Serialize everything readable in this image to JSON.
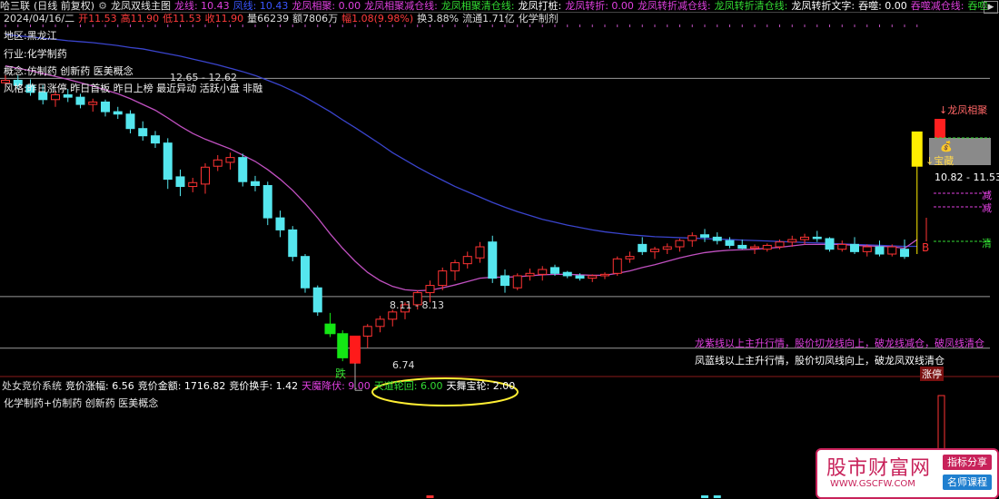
{
  "topbar": {
    "stock": "哈三联",
    "period": "(日线 前复权)",
    "indicator": "龙凤双线主图",
    "items": [
      {
        "text": "龙线: 10.43",
        "color": "#e040e0"
      },
      {
        "text": "凤线: 10.43",
        "color": "#3a55ff"
      },
      {
        "text": "龙凤相聚: 0.00",
        "color": "#e040e0"
      },
      {
        "text": "龙凤相聚减仓线:",
        "color": "#e040e0"
      },
      {
        "text": "龙凤相聚清仓线:",
        "color": "#33dd33"
      },
      {
        "text": "龙凤打桩:",
        "color": "#ffffff"
      },
      {
        "text": "龙凤转折: 0.00",
        "color": "#e040e0"
      },
      {
        "text": "龙凤转折减仓线:",
        "color": "#e040e0"
      },
      {
        "text": "龙凤转折清仓线:",
        "color": "#33dd33"
      },
      {
        "text": "龙凤转折文字:",
        "color": "#ffffff"
      },
      {
        "text": "吞噬: 0.00",
        "color": "#ffffff"
      },
      {
        "text": "吞噬减仓线:",
        "color": "#e040e0"
      },
      {
        "text": "吞噬:",
        "color": "#33dd33"
      }
    ]
  },
  "statline": [
    {
      "text": "2024/04/16/二",
      "color": "#dddddd"
    },
    {
      "text": "开11.53",
      "color": "#ff3b3b"
    },
    {
      "text": "高11.90",
      "color": "#ff3b3b"
    },
    {
      "text": "低11.53",
      "color": "#ff3b3b"
    },
    {
      "text": "收11.90",
      "color": "#ff3b3b"
    },
    {
      "text": "量66239",
      "color": "#dddddd"
    },
    {
      "text": "额7806万",
      "color": "#dddddd"
    },
    {
      "text": "幅1.08(9.98%)",
      "color": "#ff3b3b"
    },
    {
      "text": "换3.88%",
      "color": "#dddddd"
    },
    {
      "text": "流通1.71亿",
      "color": "#dddddd"
    },
    {
      "text": "化学制剂",
      "color": "#dddddd"
    }
  ],
  "labels": {
    "l1": "地区:黑龙江",
    "l2": "行业:化学制药",
    "l3": "概念:仿制药 创新药 医美概念",
    "l4": "风格:昨日涨停 昨日首板 昨日上榜 最近异动 活跃小盘 非融",
    "range1": "12.65 - 12.62",
    "range2": "8.11 - 8.13",
    "low": "6.74",
    "range3": "10.82 - 11.53",
    "die": "跌",
    "B": "B",
    "longxiang": "↓龙凤相聚",
    "baowuz": "↓宝藏",
    "jian1": "减",
    "jian2": "减",
    "qing": "清",
    "note1": "龙紫线以上主升行情，股价切龙线向上，破龙线减仓，破凤线清仓",
    "note2": "凤蓝线以上主升行情，股价切凤线向上，破龙凤双线清仓",
    "zhangting": "涨停"
  },
  "subbar": [
    {
      "text": "处女竞价系统",
      "color": "#dddddd"
    },
    {
      "text": "竞价涨幅: 6.56",
      "color": "#ffffff"
    },
    {
      "text": "竞价金额: 1716.82",
      "color": "#ffffff"
    },
    {
      "text": "竞价换手: 1.42",
      "color": "#ffffff"
    },
    {
      "text": "天魔降伏: 9.00",
      "color": "#e040e0"
    },
    {
      "text": "天道轮回: 6.00",
      "color": "#33dd33"
    },
    {
      "text": "天舞宝轮: 2.00",
      "color": "#ffffff"
    }
  ],
  "subconcept": "化学制药+仿制药 创新药 医美概念",
  "watermark": {
    "big": "股市财富网",
    "site": "WWW.GSCFW.COM",
    "b1": "指标分享",
    "b2": "名师课程"
  },
  "colors": {
    "up": "#ff3333",
    "down": "#55e6ee",
    "limitup": "#ff1a1a",
    "limitdown": "#14e614",
    "long": "#c050c0",
    "feng": "#3a44cc"
  },
  "chart_data": {
    "type": "candlestick",
    "title": "龙凤双线主图",
    "candles": [
      {
        "o": 12.55,
        "h": 12.72,
        "l": 12.45,
        "c": 12.6
      },
      {
        "o": 12.6,
        "h": 12.7,
        "l": 12.42,
        "c": 12.5
      },
      {
        "o": 12.5,
        "h": 12.62,
        "l": 12.28,
        "c": 12.35
      },
      {
        "o": 12.35,
        "h": 12.5,
        "l": 12.1,
        "c": 12.2
      },
      {
        "o": 12.2,
        "h": 12.38,
        "l": 12.05,
        "c": 12.3
      },
      {
        "o": 12.3,
        "h": 12.42,
        "l": 12.15,
        "c": 12.25
      },
      {
        "o": 12.25,
        "h": 12.32,
        "l": 12.02,
        "c": 12.1
      },
      {
        "o": 12.1,
        "h": 12.22,
        "l": 11.95,
        "c": 12.15
      },
      {
        "o": 12.15,
        "h": 12.2,
        "l": 11.85,
        "c": 11.95
      },
      {
        "o": 11.95,
        "h": 12.05,
        "l": 11.8,
        "c": 11.9
      },
      {
        "o": 11.9,
        "h": 11.98,
        "l": 11.5,
        "c": 11.6
      },
      {
        "o": 11.6,
        "h": 11.75,
        "l": 11.35,
        "c": 11.45
      },
      {
        "o": 11.45,
        "h": 11.55,
        "l": 11.2,
        "c": 11.3
      },
      {
        "o": 11.3,
        "h": 11.4,
        "l": 10.35,
        "c": 10.55
      },
      {
        "o": 10.6,
        "h": 10.75,
        "l": 10.2,
        "c": 10.4
      },
      {
        "o": 10.4,
        "h": 10.58,
        "l": 10.28,
        "c": 10.48
      },
      {
        "o": 10.45,
        "h": 10.88,
        "l": 10.25,
        "c": 10.8
      },
      {
        "o": 10.82,
        "h": 11.05,
        "l": 10.72,
        "c": 10.95
      },
      {
        "o": 10.9,
        "h": 11.1,
        "l": 10.75,
        "c": 11.0
      },
      {
        "o": 11.0,
        "h": 11.08,
        "l": 10.4,
        "c": 10.5
      },
      {
        "o": 10.5,
        "h": 10.62,
        "l": 10.3,
        "c": 10.42
      },
      {
        "o": 10.42,
        "h": 10.5,
        "l": 9.6,
        "c": 9.75
      },
      {
        "o": 9.75,
        "h": 9.9,
        "l": 9.35,
        "c": 9.5
      },
      {
        "o": 9.5,
        "h": 9.58,
        "l": 8.85,
        "c": 8.95
      },
      {
        "o": 8.95,
        "h": 9.0,
        "l": 8.2,
        "c": 8.3
      },
      {
        "o": 8.3,
        "h": 8.35,
        "l": 7.72,
        "c": 7.8
      },
      {
        "o": 7.55,
        "h": 7.78,
        "l": 7.28,
        "c": 7.35
      },
      {
        "o": 7.35,
        "h": 7.42,
        "l": 6.78,
        "c": 6.85
      },
      {
        "o": 6.74,
        "h": 7.3,
        "l": 6.74,
        "c": 7.3
      },
      {
        "o": 7.3,
        "h": 7.55,
        "l": 7.05,
        "c": 7.5
      },
      {
        "o": 7.5,
        "h": 7.72,
        "l": 7.38,
        "c": 7.65
      },
      {
        "o": 7.65,
        "h": 7.85,
        "l": 7.5,
        "c": 7.8
      },
      {
        "o": 7.8,
        "h": 8.0,
        "l": 7.65,
        "c": 7.95
      },
      {
        "o": 7.95,
        "h": 8.25,
        "l": 7.85,
        "c": 8.2
      },
      {
        "o": 8.2,
        "h": 8.45,
        "l": 8.0,
        "c": 8.35
      },
      {
        "o": 8.35,
        "h": 8.72,
        "l": 8.25,
        "c": 8.65
      },
      {
        "o": 8.65,
        "h": 8.88,
        "l": 8.45,
        "c": 8.82
      },
      {
        "o": 8.8,
        "h": 9.05,
        "l": 8.7,
        "c": 8.95
      },
      {
        "o": 8.92,
        "h": 9.25,
        "l": 8.82,
        "c": 9.15
      },
      {
        "o": 9.25,
        "h": 9.38,
        "l": 8.4,
        "c": 8.5
      },
      {
        "o": 8.55,
        "h": 8.68,
        "l": 8.2,
        "c": 8.35
      },
      {
        "o": 8.3,
        "h": 8.6,
        "l": 8.25,
        "c": 8.55
      },
      {
        "o": 8.55,
        "h": 8.7,
        "l": 8.45,
        "c": 8.6
      },
      {
        "o": 8.58,
        "h": 8.75,
        "l": 8.45,
        "c": 8.68
      },
      {
        "o": 8.72,
        "h": 8.78,
        "l": 8.55,
        "c": 8.6
      },
      {
        "o": 8.62,
        "h": 8.65,
        "l": 8.5,
        "c": 8.55
      },
      {
        "o": 8.55,
        "h": 8.6,
        "l": 8.45,
        "c": 8.5
      },
      {
        "o": 8.5,
        "h": 8.58,
        "l": 8.42,
        "c": 8.55
      },
      {
        "o": 8.55,
        "h": 8.62,
        "l": 8.48,
        "c": 8.58
      },
      {
        "o": 8.6,
        "h": 8.95,
        "l": 8.55,
        "c": 8.9
      },
      {
        "o": 8.9,
        "h": 9.05,
        "l": 8.82,
        "c": 8.95
      },
      {
        "o": 9.2,
        "h": 9.35,
        "l": 8.98,
        "c": 9.05
      },
      {
        "o": 9.05,
        "h": 9.15,
        "l": 8.9,
        "c": 9.1
      },
      {
        "o": 9.1,
        "h": 9.22,
        "l": 9.0,
        "c": 9.15
      },
      {
        "o": 9.15,
        "h": 9.32,
        "l": 9.05,
        "c": 9.28
      },
      {
        "o": 9.28,
        "h": 9.45,
        "l": 9.15,
        "c": 9.38
      },
      {
        "o": 9.4,
        "h": 9.52,
        "l": 9.25,
        "c": 9.35
      },
      {
        "o": 9.35,
        "h": 9.45,
        "l": 9.2,
        "c": 9.28
      },
      {
        "o": 9.28,
        "h": 9.35,
        "l": 9.12,
        "c": 9.18
      },
      {
        "o": 9.18,
        "h": 9.3,
        "l": 9.1,
        "c": 9.12
      },
      {
        "o": 9.12,
        "h": 9.2,
        "l": 9.0,
        "c": 9.15
      },
      {
        "o": 9.1,
        "h": 9.22,
        "l": 9.05,
        "c": 9.18
      },
      {
        "o": 9.15,
        "h": 9.3,
        "l": 9.1,
        "c": 9.25
      },
      {
        "o": 9.25,
        "h": 9.38,
        "l": 9.15,
        "c": 9.3
      },
      {
        "o": 9.3,
        "h": 9.42,
        "l": 9.2,
        "c": 9.35
      },
      {
        "o": 9.35,
        "h": 9.48,
        "l": 9.25,
        "c": 9.32
      },
      {
        "o": 9.32,
        "h": 9.35,
        "l": 9.05,
        "c": 9.1
      },
      {
        "o": 9.1,
        "h": 9.28,
        "l": 9.05,
        "c": 9.2
      },
      {
        "o": 9.2,
        "h": 9.35,
        "l": 9.0,
        "c": 9.05
      },
      {
        "o": 9.05,
        "h": 9.2,
        "l": 8.95,
        "c": 9.15
      },
      {
        "o": 9.15,
        "h": 9.28,
        "l": 8.95,
        "c": 9.0
      },
      {
        "o": 9.0,
        "h": 9.2,
        "l": 8.95,
        "c": 9.15
      },
      {
        "o": 9.1,
        "h": 9.3,
        "l": 8.9,
        "c": 8.95
      },
      {
        "o": 10.82,
        "h": 11.53,
        "l": 9.0,
        "c": 11.53
      }
    ],
    "long_line": [
      12.9,
      12.85,
      12.8,
      12.74,
      12.68,
      12.62,
      12.55,
      12.48,
      12.4,
      12.32,
      12.22,
      12.1,
      11.98,
      11.82,
      11.65,
      11.5,
      11.38,
      11.28,
      11.18,
      11.05,
      10.92,
      10.75,
      10.55,
      10.32,
      10.05,
      9.75,
      9.42,
      9.12,
      8.85,
      8.62,
      8.45,
      8.33,
      8.26,
      8.24,
      8.25,
      8.3,
      8.36,
      8.43,
      8.5,
      8.52,
      8.52,
      8.53,
      8.55,
      8.57,
      8.58,
      8.58,
      8.57,
      8.56,
      8.56,
      8.6,
      8.65,
      8.72,
      8.78,
      8.85,
      8.92,
      8.98,
      9.03,
      9.06,
      9.08,
      9.09,
      9.1,
      9.12,
      9.14,
      9.17,
      9.2,
      9.2,
      9.2,
      9.2,
      9.18,
      9.17,
      9.16,
      9.15,
      9.12,
      9.3
    ],
    "feng_line": [
      13.55,
      13.52,
      13.5,
      13.47,
      13.45,
      13.42,
      13.4,
      13.38,
      13.35,
      13.32,
      13.28,
      13.25,
      13.2,
      13.15,
      13.1,
      13.04,
      12.98,
      12.92,
      12.85,
      12.78,
      12.7,
      12.6,
      12.5,
      12.38,
      12.25,
      12.1,
      11.95,
      11.78,
      11.62,
      11.45,
      11.28,
      11.1,
      10.95,
      10.8,
      10.66,
      10.53,
      10.4,
      10.29,
      10.18,
      10.07,
      9.97,
      9.88,
      9.8,
      9.72,
      9.66,
      9.6,
      9.55,
      9.5,
      9.46,
      9.43,
      9.4,
      9.38,
      9.36,
      9.35,
      9.34,
      9.33,
      9.32,
      9.31,
      9.3,
      9.29,
      9.28,
      9.27,
      9.26,
      9.25,
      9.24,
      9.23,
      9.22,
      9.21,
      9.2,
      9.19,
      9.18,
      9.17,
      9.16,
      9.16
    ],
    "hlines": [
      12.64,
      8.12,
      7.05
    ],
    "limit_up_sub": 45,
    "sub_bars": [
      {
        "i": 34,
        "v": 1.2
      },
      {
        "i": 56,
        "v": 1.5
      },
      {
        "i": 57,
        "v": 2.0
      }
    ]
  }
}
